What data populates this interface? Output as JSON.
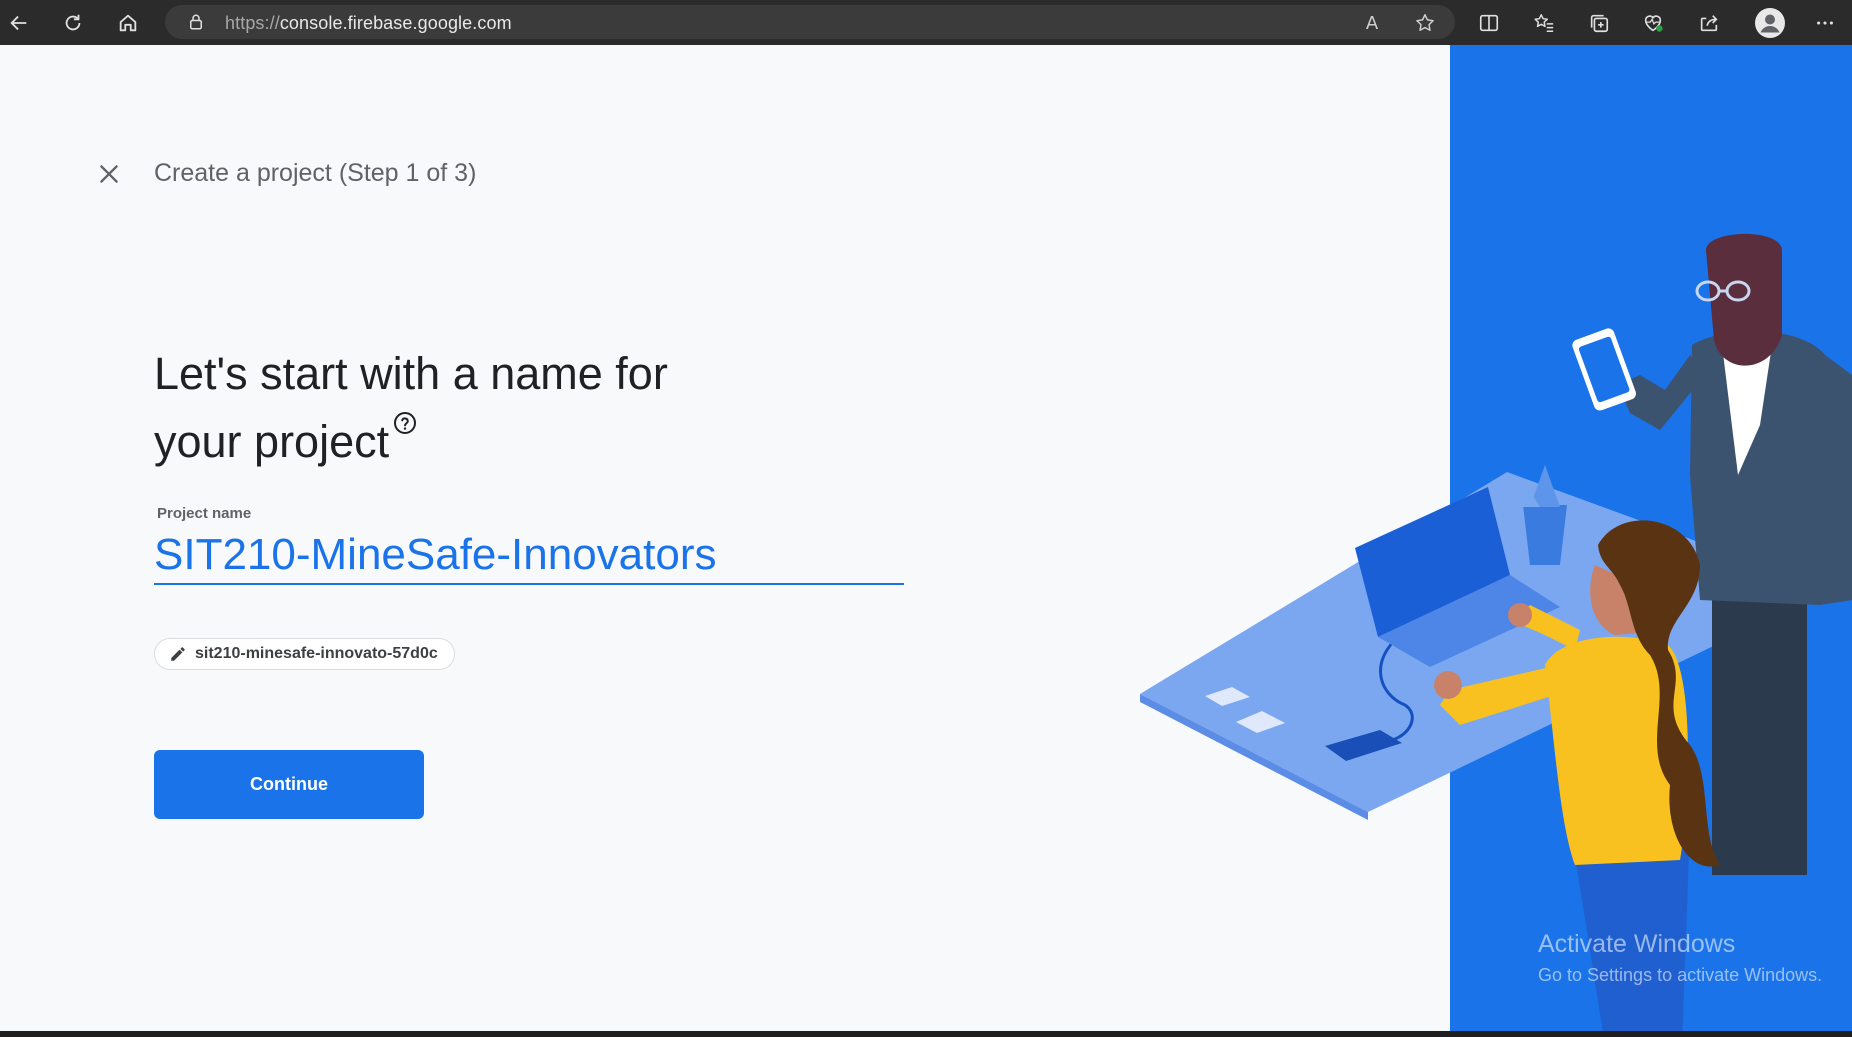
{
  "browser": {
    "url_scheme": "https://",
    "url_host": "console.firebase.google.com",
    "read_aloud_label": "A",
    "icons": [
      "back-icon",
      "refresh-icon",
      "home-icon",
      "lock-icon",
      "read-aloud-icon",
      "favorite-star-icon",
      "split-screen-icon",
      "favorites-icon",
      "collections-icon",
      "browser-essentials-icon",
      "share-icon",
      "profile-icon",
      "more-icon"
    ]
  },
  "dialog": {
    "step_title": "Create a project (Step 1 of 3)",
    "heading_line1": "Let's start with a name for",
    "heading_line2": "your project",
    "project_name_label": "Project name",
    "project_name_value": "SIT210-MineSafe-Innovators",
    "project_id": "sit210-minesafe-innovato-57d0c",
    "continue_label": "Continue"
  },
  "watermark": {
    "title": "Activate Windows",
    "subtitle": "Go to Settings to activate Windows."
  },
  "colors": {
    "accent": "#1a73e8",
    "page_bg": "#f8f9fa",
    "chrome_bg": "#2b2b2b"
  }
}
